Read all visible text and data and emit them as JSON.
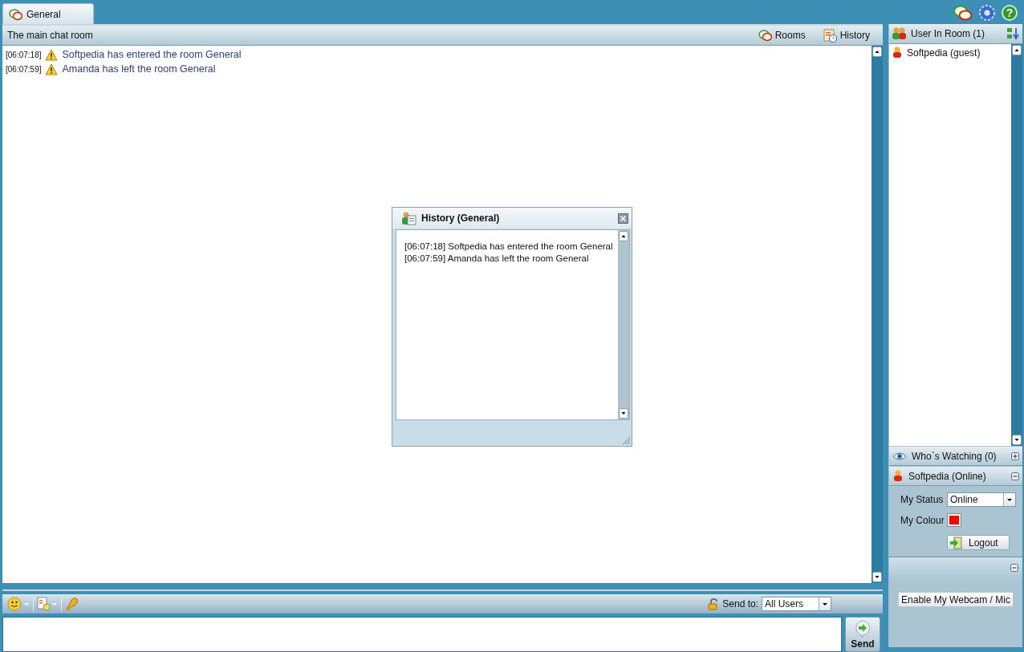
{
  "tabs": [
    {
      "label": "General",
      "selected": true
    }
  ],
  "help_button": "?",
  "room": {
    "title": "The main chat room",
    "actions": [
      {
        "label": "Rooms",
        "kind": "rooms"
      },
      {
        "label": "History",
        "kind": "history"
      }
    ]
  },
  "messages": [
    {
      "time": "[06:07:18]",
      "text": "Softpedia has entered the room General"
    },
    {
      "time": "[06:07:59]",
      "text": "Amanda has left the room General"
    }
  ],
  "composer": {
    "send_to_label": "Send to:",
    "send_to_value": "All Users",
    "send_button": "Send"
  },
  "users_panel": {
    "title": "User In Room (1)",
    "users": [
      {
        "name": "Softpedia (guest)"
      }
    ]
  },
  "watching": {
    "title": "Who`s Watching (0)",
    "expanded": false
  },
  "profile": {
    "title": "Softpedia (Online)",
    "expanded": true,
    "status_label": "My Status",
    "status_value": "Online",
    "colour_label": "My Colour",
    "color": "#ff0000",
    "logout": "Logout"
  },
  "media": {
    "expanded": true,
    "button": "Enable My Webcam / Mic"
  },
  "history_dialog": {
    "title": "History (General)",
    "lines": [
      "[06:07:18] Softpedia has entered the room General",
      "[06:07:59] Amanda has left the room General"
    ]
  }
}
